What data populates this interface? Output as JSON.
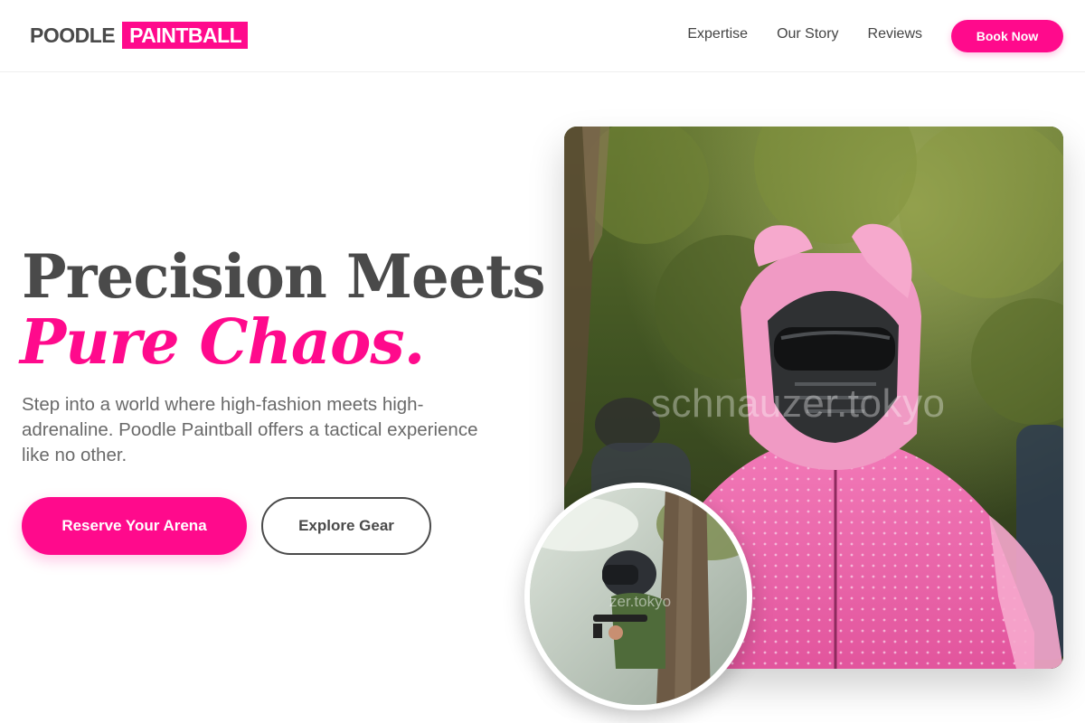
{
  "brand": {
    "logo_main": "POODLE",
    "logo_accent": "PAINTBALL",
    "accent_color": "#ff0a8c",
    "text_color": "#4a4a4a"
  },
  "nav": {
    "items": [
      {
        "label": "Expertise"
      },
      {
        "label": "Our Story"
      },
      {
        "label": "Reviews"
      }
    ],
    "book_label": "Book Now"
  },
  "hero": {
    "headline_line1": "Precision Meets",
    "headline_line2": "Pure Chaos.",
    "subtext": "Step into a world where high-fashion meets high-adrenaline. Poodle Paintball offers a tactical experience like no other.",
    "cta_primary": "Reserve Your Arena",
    "cta_secondary": "Explore Gear"
  },
  "images": {
    "main_watermark": "schnauzer.tokyo",
    "inset_watermark": "zer.tokyo"
  }
}
